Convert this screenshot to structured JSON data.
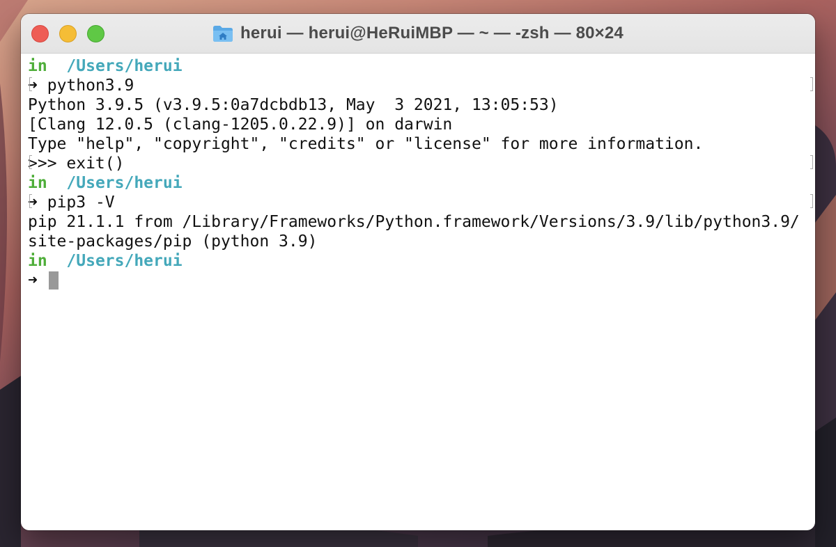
{
  "colors": {
    "close": "#ee5d55",
    "minimize": "#f5bd36",
    "zoom": "#5fc845",
    "prompt_in": "#4fae3a",
    "prompt_path": "#44a8ba",
    "text": "#111111",
    "cursor": "#999999"
  },
  "window": {
    "title": "herui — herui@HeRuiMBP — ~ — -zsh — 80×24",
    "title_icon": "home-folder-icon"
  },
  "terminal": {
    "prompt1": {
      "in": "in",
      "path": "/Users/herui"
    },
    "cmd1": {
      "arrow": "➜",
      "text": "python3.9"
    },
    "out1": "Python 3.9.5 (v3.9.5:0a7dcbdb13, May  3 2021, 13:05:53)",
    "out2": "[Clang 12.0.5 (clang-1205.0.22.9)] on darwin",
    "out3": "Type \"help\", \"copyright\", \"credits\" or \"license\" for more information.",
    "repl": ">>> exit()",
    "prompt2": {
      "in": "in",
      "path": "/Users/herui"
    },
    "cmd2": {
      "arrow": "➜",
      "text": "pip3 -V"
    },
    "out4": "pip 21.1.1 from /Library/Frameworks/Python.framework/Versions/3.9/lib/python3.9/",
    "out5": "site-packages/pip (python 3.9)",
    "prompt3": {
      "in": "in",
      "path": "/Users/herui"
    },
    "cmd3": {
      "arrow": "➜"
    }
  }
}
